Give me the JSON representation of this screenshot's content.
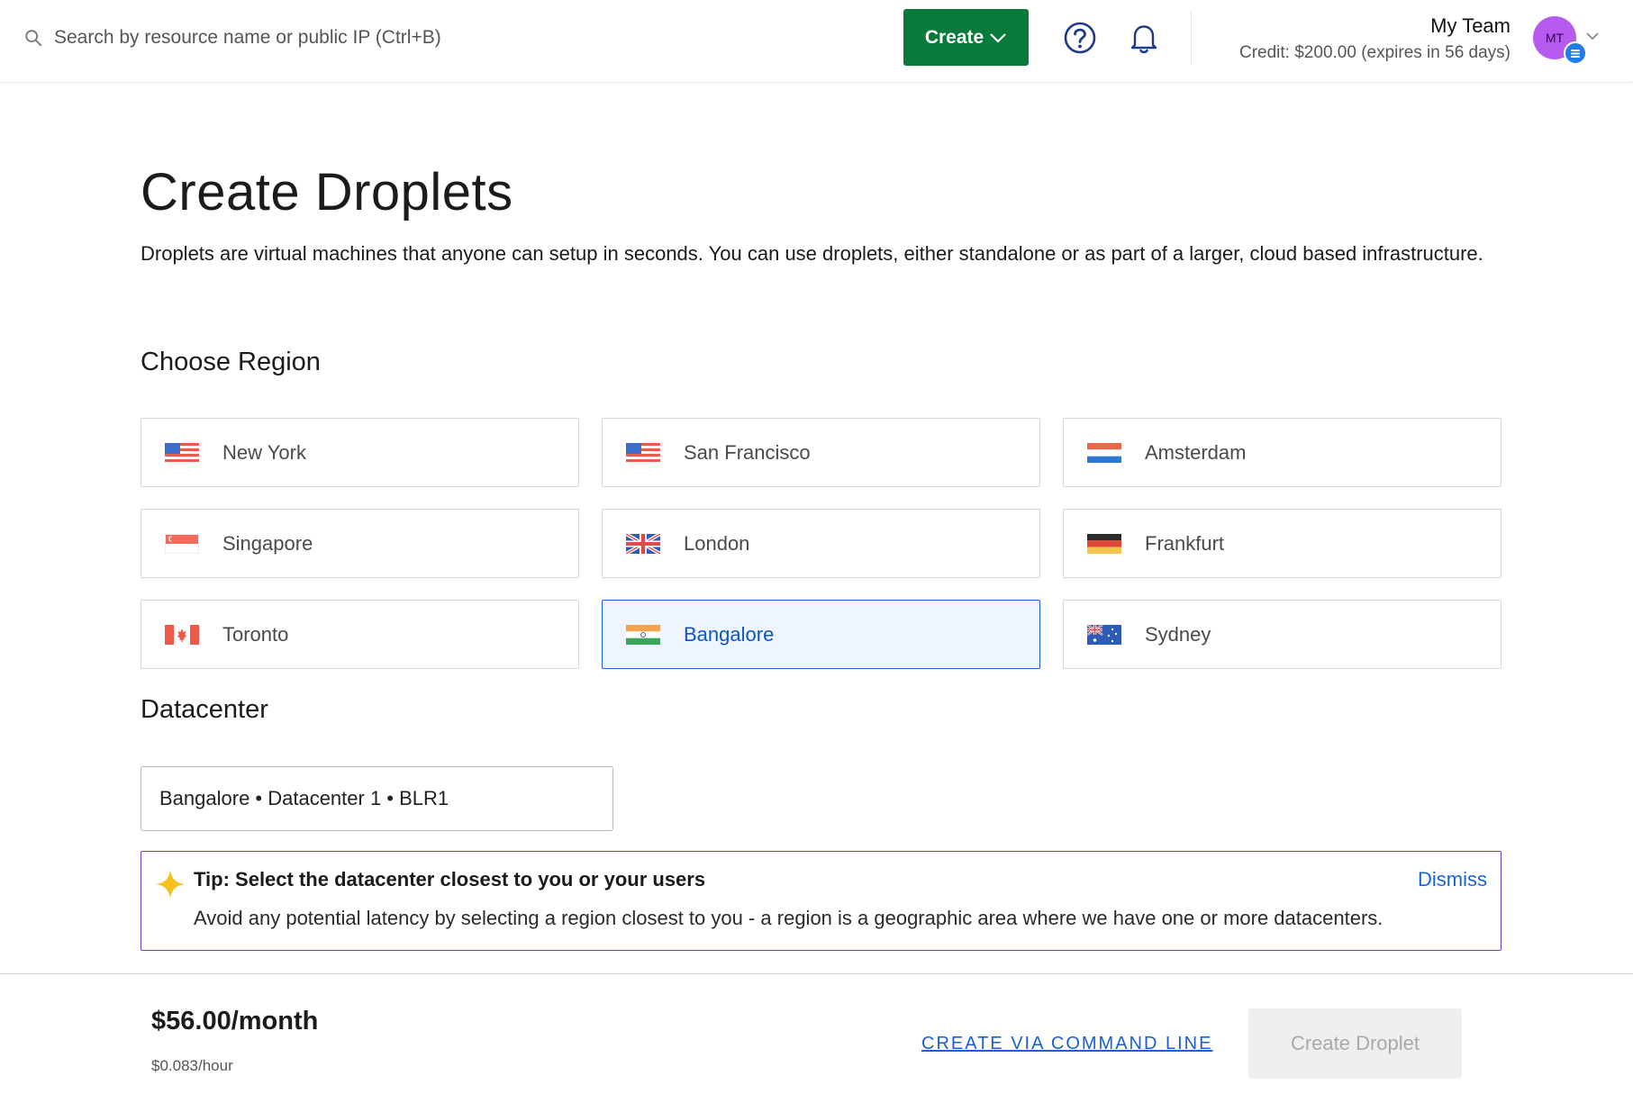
{
  "header": {
    "search_placeholder": "Search by resource name or public IP (Ctrl+B)",
    "create_label": "Create",
    "team_name": "My Team",
    "credit_text": "Credit: $200.00 (expires in 56 days)",
    "avatar_initials": "MT"
  },
  "page": {
    "title": "Create Droplets",
    "description": "Droplets are virtual machines that anyone can setup in seconds. You can use droplets, either standalone or as part of a larger, cloud based infrastructure."
  },
  "region_section": {
    "title": "Choose Region",
    "regions": [
      {
        "label": "New York",
        "flag": "us-flag-icon",
        "selected": false
      },
      {
        "label": "San Francisco",
        "flag": "us-flag-icon",
        "selected": false
      },
      {
        "label": "Amsterdam",
        "flag": "nl-flag-icon",
        "selected": false
      },
      {
        "label": "Singapore",
        "flag": "sg-flag-icon",
        "selected": false
      },
      {
        "label": "London",
        "flag": "uk-flag-icon",
        "selected": false
      },
      {
        "label": "Frankfurt",
        "flag": "de-flag-icon",
        "selected": false
      },
      {
        "label": "Toronto",
        "flag": "ca-flag-icon",
        "selected": false
      },
      {
        "label": "Bangalore",
        "flag": "in-flag-icon",
        "selected": true
      },
      {
        "label": "Sydney",
        "flag": "au-flag-icon",
        "selected": false
      }
    ]
  },
  "datacenter_section": {
    "title": "Datacenter",
    "selected_value": "Bangalore • Datacenter 1 • BLR1"
  },
  "tip": {
    "title": "Tip: Select the datacenter closest to you or your users",
    "body": "Avoid any potential latency by selecting a region closest to you - a region is a geographic area where we have one or more datacenters.",
    "dismiss_label": "Dismiss"
  },
  "footer": {
    "price_month": "$56.00/month",
    "price_hour": "$0.083/hour",
    "cli_label": "CREATE VIA COMMAND LINE",
    "create_label": "Create Droplet"
  },
  "colors": {
    "primary_green": "#0a7a3a",
    "selected_blue": "#1a5fd8",
    "tip_border": "#6a3fbf",
    "avatar": "#b65af0"
  }
}
